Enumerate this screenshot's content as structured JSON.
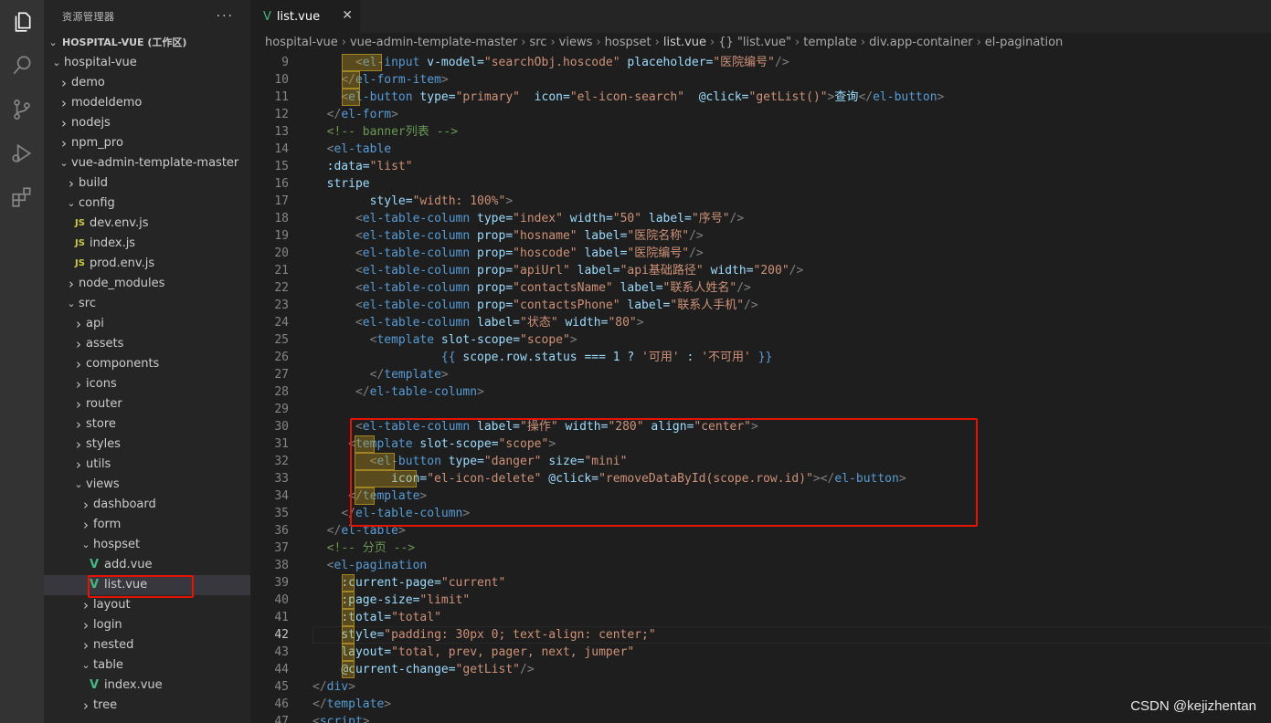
{
  "explorer": {
    "title": "资源管理器",
    "more": "···",
    "root": "HOSPITAL-VUE (工作区)",
    "items": [
      {
        "label": "hospital-vue",
        "type": "folder-open"
      },
      {
        "label": "demo",
        "type": "folder"
      },
      {
        "label": "modeldemo",
        "type": "folder"
      },
      {
        "label": "nodejs",
        "type": "folder"
      },
      {
        "label": "npm_pro",
        "type": "folder"
      },
      {
        "label": "vue-admin-template-master",
        "type": "folder-open"
      },
      {
        "label": "build",
        "type": "folder"
      },
      {
        "label": "config",
        "type": "folder-open"
      },
      {
        "label": "dev.env.js",
        "type": "js"
      },
      {
        "label": "index.js",
        "type": "js"
      },
      {
        "label": "prod.env.js",
        "type": "js"
      },
      {
        "label": "node_modules",
        "type": "folder"
      },
      {
        "label": "src",
        "type": "folder-open"
      },
      {
        "label": "api",
        "type": "folder"
      },
      {
        "label": "assets",
        "type": "folder"
      },
      {
        "label": "components",
        "type": "folder"
      },
      {
        "label": "icons",
        "type": "folder"
      },
      {
        "label": "router",
        "type": "folder"
      },
      {
        "label": "store",
        "type": "folder"
      },
      {
        "label": "styles",
        "type": "folder"
      },
      {
        "label": "utils",
        "type": "folder"
      },
      {
        "label": "views",
        "type": "folder-open"
      },
      {
        "label": "dashboard",
        "type": "folder"
      },
      {
        "label": "form",
        "type": "folder"
      },
      {
        "label": "hospset",
        "type": "folder-open"
      },
      {
        "label": "add.vue",
        "type": "vue"
      },
      {
        "label": "list.vue",
        "type": "vue",
        "selected": true
      },
      {
        "label": "layout",
        "type": "folder"
      },
      {
        "label": "login",
        "type": "folder"
      },
      {
        "label": "nested",
        "type": "folder"
      },
      {
        "label": "table",
        "type": "folder-open"
      },
      {
        "label": "index.vue",
        "type": "vue"
      },
      {
        "label": "tree",
        "type": "folder"
      }
    ]
  },
  "tab": {
    "name": "list.vue",
    "close": "✕",
    "icon": "V"
  },
  "breadcrumbs": [
    "hospital-vue",
    "vue-admin-template-master",
    "src",
    "views",
    "hospset",
    "list.vue",
    "{} \"list.vue\"",
    "template",
    "div.app-container",
    "el-pagination"
  ],
  "code_lines": [
    {
      "n": "9",
      "t": "      <el-input v-model=\"searchObj.hoscode\" placeholder=\"医院编号\"/>"
    },
    {
      "n": "10",
      "t": "    </el-form-item>"
    },
    {
      "n": "11",
      "t": "    <el-button type=\"primary\"  icon=\"el-icon-search\"  @click=\"getList()\">查询</el-button>"
    },
    {
      "n": "12",
      "t": "  </el-form>"
    },
    {
      "n": "13",
      "t": "  <!-- banner列表 -->"
    },
    {
      "n": "14",
      "t": "  <el-table"
    },
    {
      "n": "15",
      "t": "  :data=\"list\""
    },
    {
      "n": "16",
      "t": "  stripe"
    },
    {
      "n": "17",
      "t": "        style=\"width: 100%\">"
    },
    {
      "n": "18",
      "t": "      <el-table-column type=\"index\" width=\"50\" label=\"序号\"/>"
    },
    {
      "n": "19",
      "t": "      <el-table-column prop=\"hosname\" label=\"医院名称\"/>"
    },
    {
      "n": "20",
      "t": "      <el-table-column prop=\"hoscode\" label=\"医院编号\"/>"
    },
    {
      "n": "21",
      "t": "      <el-table-column prop=\"apiUrl\" label=\"api基础路径\" width=\"200\"/>"
    },
    {
      "n": "22",
      "t": "      <el-table-column prop=\"contactsName\" label=\"联系人姓名\"/>"
    },
    {
      "n": "23",
      "t": "      <el-table-column prop=\"contactsPhone\" label=\"联系人手机\"/>"
    },
    {
      "n": "24",
      "t": "      <el-table-column label=\"状态\" width=\"80\">"
    },
    {
      "n": "25",
      "t": "        <template slot-scope=\"scope\">"
    },
    {
      "n": "26",
      "t": "                  {{ scope.row.status === 1 ? '可用' : '不可用' }}"
    },
    {
      "n": "27",
      "t": "        </template>"
    },
    {
      "n": "28",
      "t": "      </el-table-column>"
    },
    {
      "n": "29",
      "t": ""
    },
    {
      "n": "30",
      "t": "      <el-table-column label=\"操作\" width=\"280\" align=\"center\">"
    },
    {
      "n": "31",
      "t": "     <template slot-scope=\"scope\">"
    },
    {
      "n": "32",
      "t": "        <el-button type=\"danger\" size=\"mini\""
    },
    {
      "n": "33",
      "t": "           icon=\"el-icon-delete\" @click=\"removeDataById(scope.row.id)\"></el-button>"
    },
    {
      "n": "34",
      "t": "     </template>"
    },
    {
      "n": "35",
      "t": "    </el-table-column>"
    },
    {
      "n": "36",
      "t": "  </el-table>"
    },
    {
      "n": "37",
      "t": "  <!-- 分页 -->"
    },
    {
      "n": "38",
      "t": "  <el-pagination"
    },
    {
      "n": "39",
      "t": "    :current-page=\"current\""
    },
    {
      "n": "40",
      "t": "    :page-size=\"limit\""
    },
    {
      "n": "41",
      "t": "    :total=\"total\""
    },
    {
      "n": "42",
      "t": "    style=\"padding: 30px 0; text-align: center;\""
    },
    {
      "n": "43",
      "t": "    layout=\"total, prev, pager, next, jumper\""
    },
    {
      "n": "44",
      "t": "    @current-change=\"getList\"/>"
    },
    {
      "n": "45",
      "t": "</div>"
    },
    {
      "n": "46",
      "t": "</template>"
    },
    {
      "n": "47",
      "t": "<script>"
    }
  ],
  "active_line": "42",
  "watermark": "CSDN @kejizhentan",
  "colors": {
    "tag": "#569cd6",
    "attr": "#9cdcfe",
    "string": "#ce9178",
    "comment": "#6a9955",
    "highlight_box": "#e51400"
  }
}
